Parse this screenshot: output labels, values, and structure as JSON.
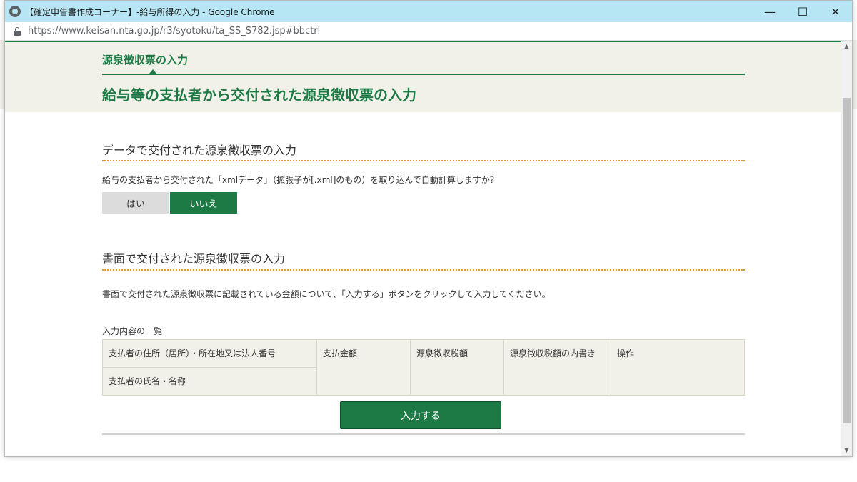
{
  "window": {
    "title": "【確定申告書作成コーナー】-給与所得の入力 - Google Chrome",
    "url": "https://www.keisan.nta.go.jp/r3/syotoku/ta_SS_S782.jsp#bbctrl",
    "minimize": "—",
    "maximize": "☐",
    "close": "✕"
  },
  "header": {
    "sub_title": "源泉徴収票の入力",
    "main_title": "給与等の支払者から交付された源泉徴収票の入力"
  },
  "data_section": {
    "title": "データで交付された源泉徴収票の入力",
    "question": "給与の支払者から交付された「xmlデータ」（拡張子が[.xml]のもの）を取り込んで自動計算しますか？",
    "yes_label": "はい",
    "no_label": "いいえ",
    "selected": "いいえ"
  },
  "paper_section": {
    "title": "書面で交付された源泉徴収票の入力",
    "description": "書面で交付された源泉徴収票に記載されている金額について、「入力する」ボタンをクリックして入力してください。",
    "table_caption": "入力内容の一覧",
    "columns": {
      "address": "支払者の住所（居所）・所在地又は法人番号",
      "name": "支払者の氏名・名称",
      "amount": "支払金額",
      "tax": "源泉徴収税額",
      "breakdown": "源泉徴収税額の内書き",
      "operation": "操作"
    },
    "input_button": "入力する"
  },
  "colors": {
    "accent_green": "#1d7a45",
    "band_beige": "#f2f1e9",
    "dotted_orange": "#e0a020",
    "titlebar_blue": "#b6e6f4"
  }
}
